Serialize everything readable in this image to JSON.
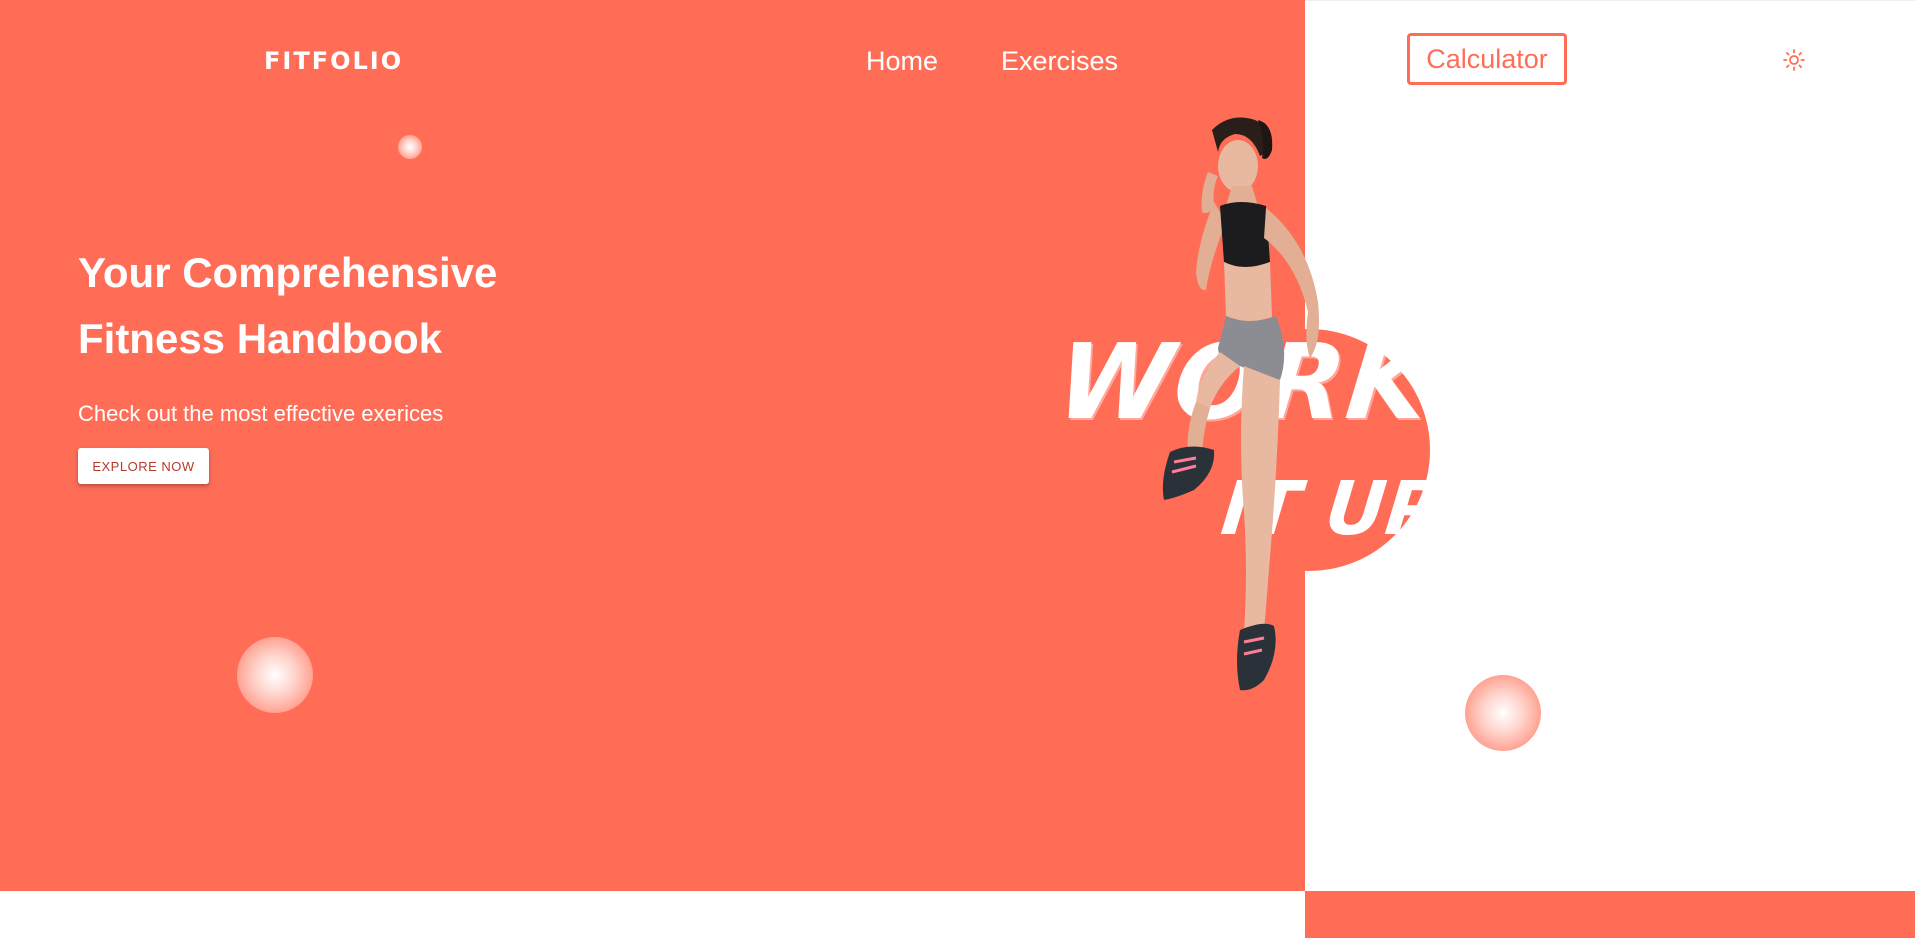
{
  "navbar": {
    "logo": "FITFOLIO",
    "links": [
      "Home",
      "Exercises"
    ],
    "calculator_button": "Calculator",
    "theme_toggle_icon": "sun-icon"
  },
  "hero": {
    "title_line1": "Your Comprehensive",
    "title_line2": "Fitness Handbook",
    "subtitle": "Check out the most effective exerices",
    "cta_button": "EXPLORE NOW"
  },
  "illustration": {
    "word1": "WORK",
    "word2": "IT UP",
    "image": "athlete-jumping-illustration"
  },
  "colors": {
    "accent": "#FF6D57",
    "background_right": "#FFFFFF",
    "cta_text": "#B53A2A"
  }
}
